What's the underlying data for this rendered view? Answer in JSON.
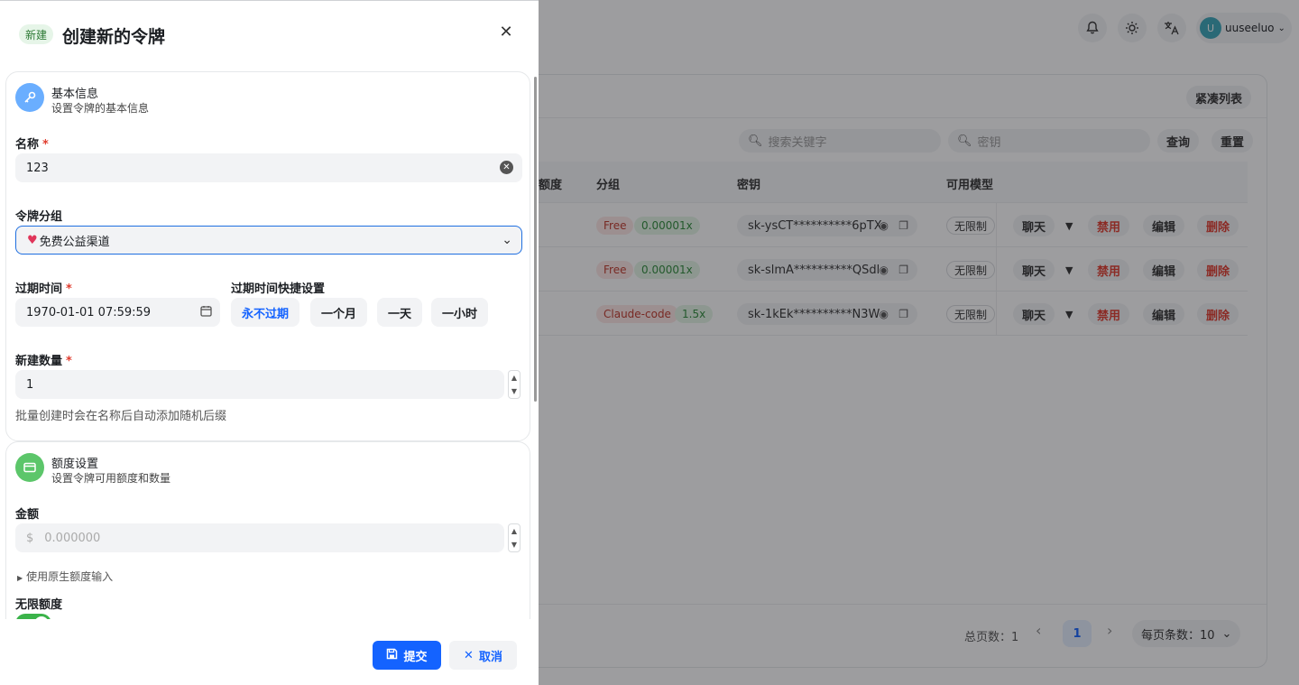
{
  "colors": {
    "primary": "#1463ff",
    "danger": "#e03c2e",
    "success": "#3bb34a"
  },
  "topbar": {
    "bell_icon": "bell-icon",
    "theme_icon": "sun-icon",
    "lang_icon": "translate-icon",
    "user": {
      "avatar": "U",
      "name": "uuseeluo"
    }
  },
  "list": {
    "compact_label": "紧凑列表",
    "search_placeholder": "搜索关键字",
    "key_placeholder": "密钥",
    "query_label": "查询",
    "reset_label": "重置",
    "columns": [
      "额度",
      "分组",
      "密钥",
      "可用模型"
    ],
    "rows": [
      {
        "group": "Free",
        "ratio": "0.00001x",
        "key": "sk-ysCT**********6pTX",
        "models": "无限制"
      },
      {
        "group": "Free",
        "ratio": "0.00001x",
        "key": "sk-slmA**********QSdl",
        "models": "无限制"
      },
      {
        "group": "Claude-code",
        "ratio": "1.5x",
        "key": "sk-1kEk**********N3W",
        "models": "无限制"
      }
    ],
    "actions": {
      "chat": "聊天",
      "disable": "禁用",
      "edit": "编辑",
      "delete": "删除"
    },
    "pagination": {
      "total_label": "总页数：1",
      "current": "1",
      "page_size": "每页条数：10"
    }
  },
  "drawer": {
    "badge": "新建",
    "title": "创建新的令牌",
    "basic": {
      "title": "基本信息",
      "subtitle": "设置令牌的基本信息",
      "name_label": "名称",
      "name_value": "123",
      "group_label": "令牌分组",
      "group_value": "免费公益渠道",
      "expire_label": "过期时间",
      "expire_value": "1970-01-01 07:59:59",
      "quick_label": "过期时间快捷设置",
      "quick_options": [
        "永不过期",
        "一个月",
        "一天",
        "一小时"
      ],
      "count_label": "新建数量",
      "count_value": "1",
      "count_hint": "批量创建时会在名称后自动添加随机后缀"
    },
    "quota": {
      "title": "额度设置",
      "subtitle": "设置令牌可用额度和数量",
      "amount_label": "金额",
      "amount_prefix": "$",
      "amount_placeholder": "0.000000",
      "native_toggle": "使用原生额度输入",
      "unlimited_label": "无限额度",
      "unlimited_on": true
    },
    "submit_label": "提交",
    "cancel_label": "取消"
  }
}
